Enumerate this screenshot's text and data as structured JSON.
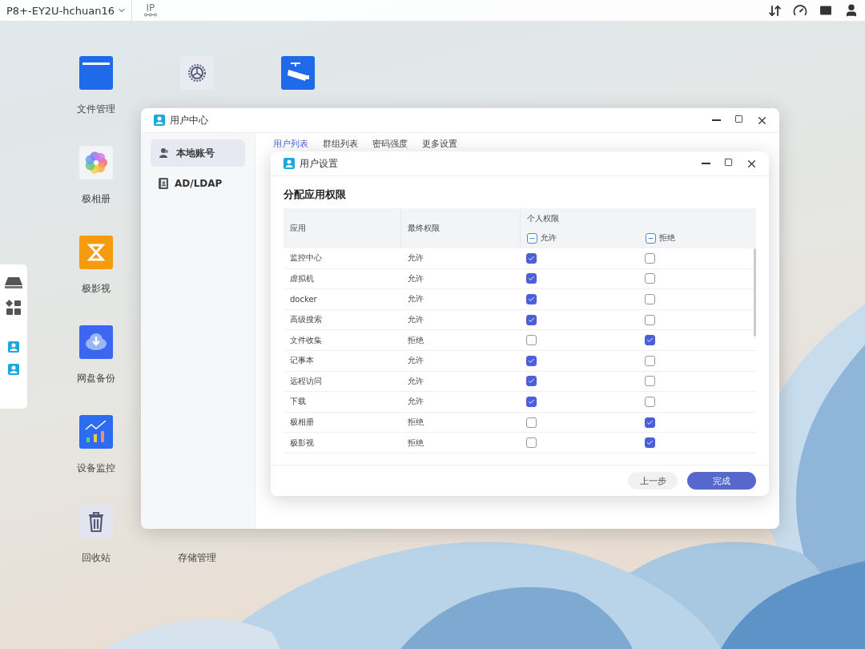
{
  "top_bar": {
    "device": "P8+-EY2U-hchuan16",
    "ip_label": "IP"
  },
  "desktop_columns": [
    [
      {
        "kind": "folder",
        "label": "文件管理"
      },
      {
        "kind": "photos",
        "label": "极相册"
      },
      {
        "kind": "video",
        "label": "极影视"
      },
      {
        "kind": "cloud",
        "label": "网盘备份"
      },
      {
        "kind": "chart",
        "label": "设备监控"
      },
      {
        "kind": "trash",
        "label": "回收站"
      }
    ],
    [
      {
        "kind": "settings"
      },
      {
        "kind": "empty"
      },
      {
        "kind": "empty"
      },
      {
        "kind": "empty"
      },
      {
        "kind": "empty"
      },
      {
        "kind": "covered",
        "label": "存储管理"
      }
    ],
    [
      {
        "kind": "camera"
      }
    ]
  ],
  "user_center": {
    "title": "用户中心",
    "sidebar": [
      {
        "label": "本地账号",
        "kind": "local",
        "selected": true
      },
      {
        "label": "AD/LDAP",
        "kind": "ldap",
        "selected": false
      }
    ],
    "tabs": [
      {
        "label": "用户列表",
        "selected": true
      },
      {
        "label": "群组列表",
        "selected": false
      },
      {
        "label": "密码强度",
        "selected": false
      },
      {
        "label": "更多设置",
        "selected": false
      }
    ]
  },
  "user_settings": {
    "title": "用户设置",
    "heading": "分配应用权限",
    "columns": {
      "app": "应用",
      "final": "最终权限",
      "personal": "个人权限",
      "allow": "允许",
      "deny": "拒绝"
    },
    "allow_all_indeterminate": true,
    "deny_all_indeterminate": true,
    "rows": [
      {
        "app": "监控中心",
        "final": "允许",
        "allow": true,
        "deny": false
      },
      {
        "app": "虚拟机",
        "final": "允许",
        "allow": true,
        "deny": false
      },
      {
        "app": "docker",
        "final": "允许",
        "allow": true,
        "deny": false
      },
      {
        "app": "高级搜索",
        "final": "允许",
        "allow": true,
        "deny": false
      },
      {
        "app": "文件收集",
        "final": "拒绝",
        "allow": false,
        "deny": true
      },
      {
        "app": "记事本",
        "final": "允许",
        "allow": true,
        "deny": false
      },
      {
        "app": "远程访问",
        "final": "允许",
        "allow": true,
        "deny": false
      },
      {
        "app": "下载",
        "final": "允许",
        "allow": true,
        "deny": false
      },
      {
        "app": "极相册",
        "final": "拒绝",
        "allow": false,
        "deny": true
      },
      {
        "app": "极影视",
        "final": "拒绝",
        "allow": false,
        "deny": true
      }
    ],
    "buttons": {
      "back": "上一步",
      "done": "完成"
    }
  }
}
